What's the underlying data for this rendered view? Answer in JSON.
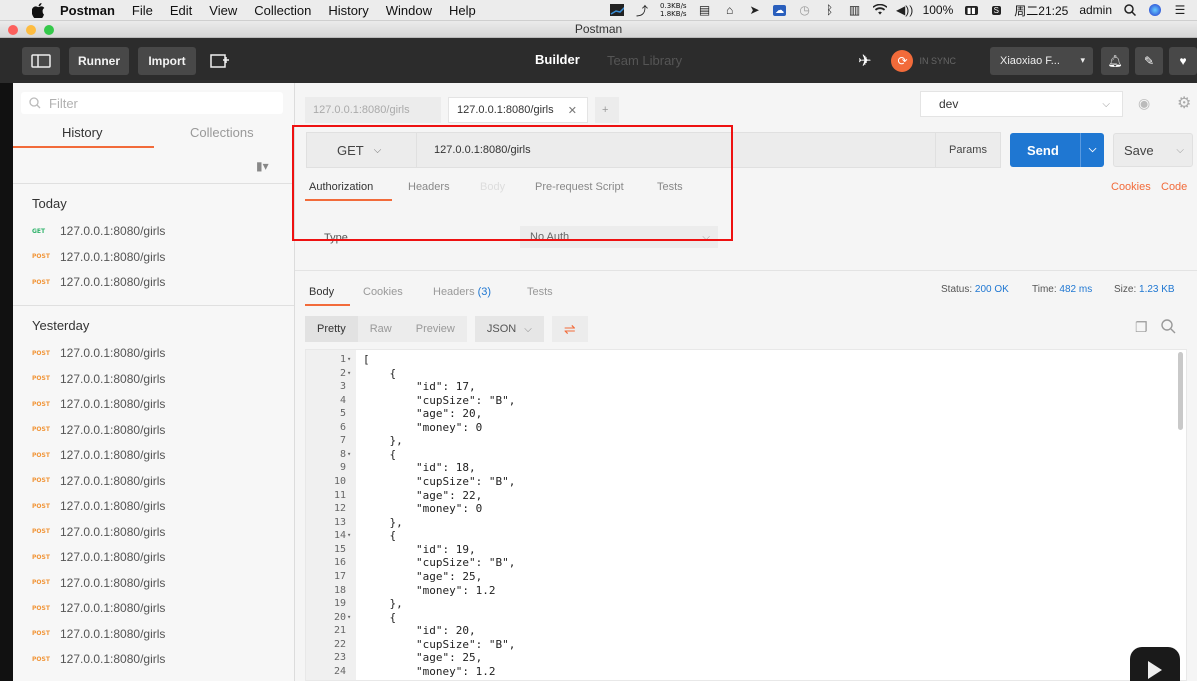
{
  "menubar": {
    "app": "Postman",
    "items": [
      "File",
      "Edit",
      "View",
      "Collection",
      "History",
      "Window",
      "Help"
    ],
    "net_up": "0.3KB/s",
    "net_down": "1.8KB/s",
    "battery": "100%",
    "clock": "周二21:25",
    "user": "admin"
  },
  "window": {
    "title": "Postman"
  },
  "header": {
    "runner": "Runner",
    "import": "Import",
    "builder": "Builder",
    "team_library": "Team Library",
    "sync": "IN SYNC",
    "account": "Xiaoxiao F..."
  },
  "sidebar": {
    "filter_placeholder": "Filter",
    "tab_history": "History",
    "tab_collections": "Collections",
    "today_label": "Today",
    "yesterday_label": "Yesterday",
    "today": [
      {
        "method": "GET",
        "url": "127.0.0.1:8080/girls"
      },
      {
        "method": "POST",
        "url": "127.0.0.1:8080/girls"
      },
      {
        "method": "POST",
        "url": "127.0.0.1:8080/girls"
      }
    ],
    "yesterday": [
      {
        "method": "POST",
        "url": "127.0.0.1:8080/girls"
      },
      {
        "method": "POST",
        "url": "127.0.0.1:8080/girls"
      },
      {
        "method": "POST",
        "url": "127.0.0.1:8080/girls"
      },
      {
        "method": "POST",
        "url": "127.0.0.1:8080/girls"
      },
      {
        "method": "POST",
        "url": "127.0.0.1:8080/girls"
      },
      {
        "method": "POST",
        "url": "127.0.0.1:8080/girls"
      },
      {
        "method": "POST",
        "url": "127.0.0.1:8080/girls"
      },
      {
        "method": "POST",
        "url": "127.0.0.1:8080/girls"
      },
      {
        "method": "POST",
        "url": "127.0.0.1:8080/girls"
      },
      {
        "method": "POST",
        "url": "127.0.0.1:8080/girls"
      },
      {
        "method": "POST",
        "url": "127.0.0.1:8080/girls"
      },
      {
        "method": "POST",
        "url": "127.0.0.1:8080/girls"
      },
      {
        "method": "POST",
        "url": "127.0.0.1:8080/girls"
      }
    ]
  },
  "tabs": [
    {
      "label": "127.0.0.1:8080/girls",
      "active": false
    },
    {
      "label": "127.0.0.1:8080/girls",
      "active": true
    }
  ],
  "environment": "dev",
  "request": {
    "method": "GET",
    "url": "127.0.0.1:8080/girls",
    "params": "Params",
    "send": "Send",
    "save": "Save",
    "subtabs": [
      "Authorization",
      "Headers",
      "Body",
      "Pre-request Script",
      "Tests"
    ],
    "cookies": "Cookies",
    "code": "Code",
    "auth_type_label": "Type",
    "auth_type_value": "No Auth"
  },
  "response": {
    "tabs": [
      "Body",
      "Cookies",
      "Headers",
      "Tests"
    ],
    "headers_count": "(3)",
    "status_label": "Status:",
    "status": "200 OK",
    "time_label": "Time:",
    "time": "482 ms",
    "size_label": "Size:",
    "size": "1.23 KB",
    "formats": [
      "Pretty",
      "Raw",
      "Preview"
    ],
    "format_type": "JSON",
    "body_lines": [
      "[",
      "    {",
      "        \"id\": 17,",
      "        \"cupSize\": \"B\",",
      "        \"age\": 20,",
      "        \"money\": 0",
      "    },",
      "    {",
      "        \"id\": 18,",
      "        \"cupSize\": \"B\",",
      "        \"age\": 22,",
      "        \"money\": 0",
      "    },",
      "    {",
      "        \"id\": 19,",
      "        \"cupSize\": \"B\",",
      "        \"age\": 25,",
      "        \"money\": 1.2",
      "    },",
      "    {",
      "        \"id\": 20,",
      "        \"cupSize\": \"B\",",
      "        \"age\": 25,",
      "        \"money\": 1.2"
    ],
    "fold_lines": [
      1,
      2,
      8,
      14,
      20
    ]
  },
  "colors": {
    "accent": "#f26b3a",
    "send": "#1f77d2",
    "get": "#2fb36b",
    "post": "#f1963a",
    "highlight": "#ee1111"
  }
}
